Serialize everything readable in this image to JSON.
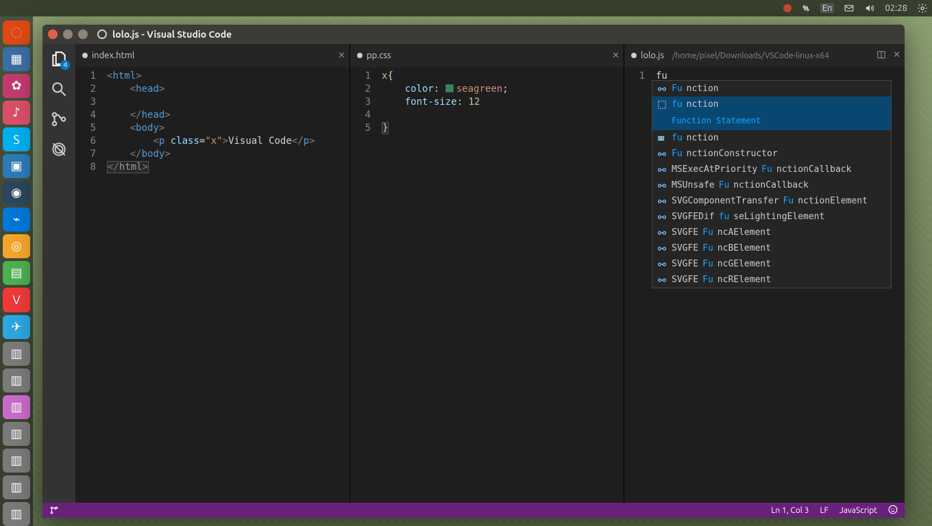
{
  "system": {
    "clock": "02:28",
    "lang_indicator": "En"
  },
  "window": {
    "title": "lolo.js - Visual Studio Code"
  },
  "activitybar": {
    "explorer_badge": "4"
  },
  "panes": [
    {
      "tab": "index.html",
      "dirty": true,
      "lines": [
        "1",
        "2",
        "3",
        "4",
        "5",
        "6",
        "7",
        "8"
      ]
    },
    {
      "tab": "pp.css",
      "dirty": true,
      "lines": [
        "1",
        "2",
        "3",
        "4",
        "5"
      ],
      "css": {
        "selector": "x",
        "prop1": "color",
        "val1": "seagreen",
        "prop2": "font-size",
        "val2": "12"
      }
    },
    {
      "tab": "lolo.js",
      "dirty": true,
      "path": "/home/pixel/Downloads/VSCode-linux-x64",
      "lines": [
        "1"
      ],
      "typed": "fu"
    }
  ],
  "html_code": {
    "html": "html",
    "head": "head",
    "body": "body",
    "p": "p",
    "class_attr": "class",
    "class_val": "\"x\"",
    "text": "Visual Code"
  },
  "suggestions": {
    "detail": "Function Statement",
    "items": [
      {
        "kind": "var",
        "pre": "Fu",
        "rest": "nction"
      },
      {
        "kind": "snip",
        "pre": "fu",
        "rest": "nction",
        "selected": true
      },
      {
        "kind": "key",
        "pre": "fu",
        "rest": "nction"
      },
      {
        "kind": "var",
        "pre": "Fu",
        "rest": "nctionConstructor"
      },
      {
        "kind": "var",
        "preA": "MSExecAtPriority",
        "mid": "Fu",
        "rest": "nctionCallback"
      },
      {
        "kind": "var",
        "preA": "MSUnsafe",
        "mid": "Fu",
        "rest": "nctionCallback"
      },
      {
        "kind": "var",
        "preA": "SVGComponentTransfer",
        "mid": "Fu",
        "rest": "nctionElement"
      },
      {
        "kind": "var",
        "preA": "SVGFEDif",
        "mid": "fu",
        "rest": "seLightingElement"
      },
      {
        "kind": "var",
        "preA": "SVGFE",
        "mid": "Fu",
        "rest": "ncAElement"
      },
      {
        "kind": "var",
        "preA": "SVGFE",
        "mid": "Fu",
        "rest": "ncBElement"
      },
      {
        "kind": "var",
        "preA": "SVGFE",
        "mid": "Fu",
        "rest": "ncGElement"
      },
      {
        "kind": "var",
        "preA": "SVGFE",
        "mid": "Fu",
        "rest": "ncRElement"
      }
    ]
  },
  "statusbar": {
    "ln_col": "Ln 1, Col 3",
    "eol": "LF",
    "lang": "JavaScript"
  },
  "launcher_icons": [
    {
      "name": "ubuntu",
      "bg": "#dd4814",
      "glyph": "◌"
    },
    {
      "name": "app1",
      "bg": "#3b6ea5",
      "glyph": "▦"
    },
    {
      "name": "app2",
      "bg": "#c23b6f",
      "glyph": "✿"
    },
    {
      "name": "music",
      "bg": "#d94f6a",
      "glyph": "♪"
    },
    {
      "name": "skype",
      "bg": "#00aff0",
      "glyph": "S"
    },
    {
      "name": "app3",
      "bg": "#2b7bb9",
      "glyph": "▣"
    },
    {
      "name": "steam",
      "bg": "#2a475e",
      "glyph": "◉"
    },
    {
      "name": "vscode",
      "bg": "#0078d7",
      "glyph": "⌁"
    },
    {
      "name": "chrome",
      "bg": "#f4a62a",
      "glyph": "◎"
    },
    {
      "name": "app4",
      "bg": "#4caf50",
      "glyph": "▤"
    },
    {
      "name": "vivaldi",
      "bg": "#ef3939",
      "glyph": "V"
    },
    {
      "name": "telegram",
      "bg": "#2ca5e0",
      "glyph": "✈"
    },
    {
      "name": "app5",
      "bg": "#7a7a7a",
      "glyph": "▥"
    },
    {
      "name": "app6",
      "bg": "#7a7a7a",
      "glyph": "▥"
    },
    {
      "name": "app7",
      "bg": "#c86bc8",
      "glyph": "▥"
    },
    {
      "name": "app8",
      "bg": "#7a7a7a",
      "glyph": "▥"
    },
    {
      "name": "app9",
      "bg": "#7a7a7a",
      "glyph": "▥"
    },
    {
      "name": "app10",
      "bg": "#7a7a7a",
      "glyph": "▥"
    },
    {
      "name": "app11",
      "bg": "#7a7a7a",
      "glyph": "▥"
    }
  ]
}
